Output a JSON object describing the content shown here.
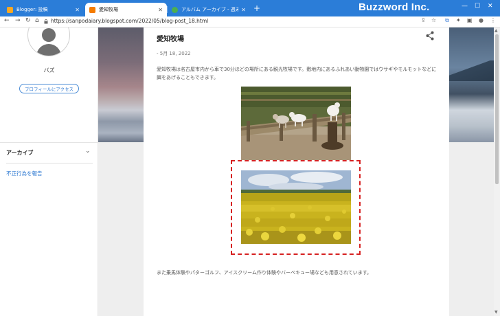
{
  "browser": {
    "tabs": [
      {
        "title": "Blogger: 投稿",
        "close": "✕",
        "favicon_color": "#f9a825"
      },
      {
        "title": "愛知牧場",
        "close": "✕",
        "favicon_color": "#f57c00"
      },
      {
        "title": "アルバム アーカイブ - 週末散歩日記",
        "close": "✕",
        "favicon_color": "#4caf50"
      }
    ],
    "new_tab": "+",
    "brand": "Buzzword Inc.",
    "window_controls": {
      "minimize": "—",
      "maximize": "☐",
      "close": "✕"
    },
    "nav": {
      "back": "←",
      "forward": "→",
      "reload": "↻",
      "home": "⌂"
    },
    "url": "https://sanpodaiary.blogspot.com/2022/05/blog-post_18.html",
    "toolbar_icons": {
      "share": "⇪",
      "bookmark": "☆",
      "extension": "⧉",
      "puzzle": "✦",
      "sidebar": "▣",
      "profile": "●",
      "menu": "⋮"
    }
  },
  "sidebar": {
    "profile_name": "バズ",
    "profile_button": "プロフィールにアクセス",
    "archive_label": "アーカイブ",
    "archive_chevron": "⌄",
    "report_link": "不正行為を報告"
  },
  "post": {
    "title": "愛知牧場",
    "date": "- 5月 18, 2022",
    "body1": "愛知牧場は名古屋市内から車で30分ほどの場所にある観光牧場です。敷地内にあるふれあい動物園ではウサギやモルモットなどに餌をあげることもできます。",
    "body2": "また乗馬体験やパターゴルフ、アイスクリーム作り体験やバーベキュー場なども用意されています。"
  },
  "scrollbar": {
    "up": "▲",
    "down": "▼"
  },
  "colors": {
    "tab_bar": "#2b7dd8",
    "link": "#2f7ad2",
    "highlight": "#d62020"
  }
}
